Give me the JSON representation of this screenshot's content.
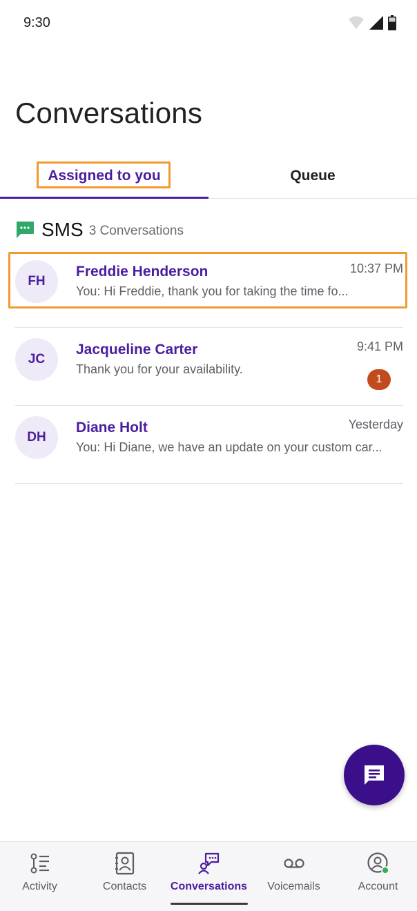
{
  "status_bar": {
    "time": "9:30"
  },
  "header": {
    "title": "Conversations"
  },
  "tabs": [
    {
      "label": "Assigned to you",
      "active": true
    },
    {
      "label": "Queue",
      "active": false
    }
  ],
  "section": {
    "title": "SMS",
    "count": "3 Conversations",
    "icon": "sms-icon"
  },
  "conversations": [
    {
      "initials": "FH",
      "name": "Freddie Henderson",
      "preview": "You: Hi Freddie, thank you for taking the time fo...",
      "time": "10:37 PM",
      "unread": ""
    },
    {
      "initials": "JC",
      "name": "Jacqueline Carter",
      "preview": "Thank you for your availability.",
      "time": "9:41 PM",
      "unread": "1"
    },
    {
      "initials": "DH",
      "name": "Diane Holt",
      "preview": "You: Hi Diane, we have an update on your custom car...",
      "time": "Yesterday",
      "unread": ""
    }
  ],
  "fab": {
    "icon": "new-message-icon"
  },
  "bottom_nav": [
    {
      "label": "Activity",
      "icon": "activity-icon",
      "active": false
    },
    {
      "label": "Contacts",
      "icon": "contacts-icon",
      "active": false
    },
    {
      "label": "Conversations",
      "icon": "conversations-icon",
      "active": true
    },
    {
      "label": "Voicemails",
      "icon": "voicemail-icon",
      "active": false
    },
    {
      "label": "Account",
      "icon": "account-icon",
      "active": false
    }
  ],
  "colors": {
    "accent": "#4a1ea0",
    "fab": "#3c0f8a",
    "highlight": "#f29a2e",
    "badge": "#c24a1c",
    "sms_green": "#2fa86a",
    "presence_online": "#2fb35a"
  }
}
